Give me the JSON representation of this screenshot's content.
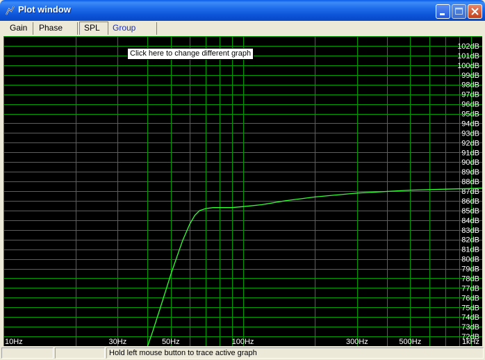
{
  "window": {
    "title": "Plot window"
  },
  "colors": {
    "grid": "#00A000",
    "trace": "#33FF33",
    "label": "#FFFFFF",
    "background": "#000000"
  },
  "icons": {
    "app": "plot-app-icon",
    "minimize": "minimize-icon",
    "maximize": "maximize-icon",
    "close": "close-icon"
  },
  "tabs": [
    {
      "label": "Gain",
      "active": false
    },
    {
      "label": "Phase plot",
      "active": false
    },
    {
      "label": "SPL",
      "active": true
    },
    {
      "label": "Group delay",
      "active": false
    }
  ],
  "tooltip": "Click here to change different graph",
  "status": {
    "left": "",
    "middle": "",
    "message": "Hold left mouse button to trace active graph"
  },
  "chart_data": {
    "type": "line",
    "x_scale": "log",
    "xlim": [
      10,
      1000
    ],
    "ylim": [
      71,
      103
    ],
    "x_ticks": [
      10,
      30,
      50,
      100,
      300,
      500,
      1000
    ],
    "x_tick_labels": [
      "10Hz",
      "30Hz",
      "50Hz",
      "100Hz",
      "300Hz",
      "500Hz",
      "1kHz"
    ],
    "y_ticks": [
      72,
      73,
      74,
      75,
      76,
      77,
      78,
      79,
      80,
      81,
      82,
      83,
      84,
      85,
      86,
      87,
      88,
      89,
      90,
      91,
      92,
      93,
      94,
      95,
      96,
      97,
      98,
      99,
      100,
      101,
      102
    ],
    "y_tick_labels": [
      "72dB",
      "73dB",
      "74dB",
      "75dB",
      "76dB",
      "77dB",
      "78dB",
      "79dB",
      "80dB",
      "81dB",
      "82dB",
      "83dB",
      "84dB",
      "85dB",
      "86dB",
      "87dB",
      "88dB",
      "89dB",
      "90dB",
      "91dB",
      "92dB",
      "93dB",
      "94dB",
      "95dB",
      "96dB",
      "97dB",
      "98dB",
      "99dB",
      "100dB",
      "101dB",
      "102dB"
    ],
    "grid": true,
    "series": [
      {
        "x": [
          40,
          42,
          45,
          48,
          50,
          53,
          56,
          60,
          63,
          66,
          70,
          75,
          80,
          90,
          100,
          120,
          150,
          200,
          300,
          500,
          700,
          1000
        ],
        "values": [
          71,
          72.5,
          74.8,
          77,
          78.4,
          80.2,
          81.9,
          83.6,
          84.5,
          85.0,
          85.2,
          85.3,
          85.3,
          85.3,
          85.4,
          85.6,
          86.0,
          86.4,
          86.8,
          87.1,
          87.2,
          87.3
        ]
      }
    ]
  }
}
